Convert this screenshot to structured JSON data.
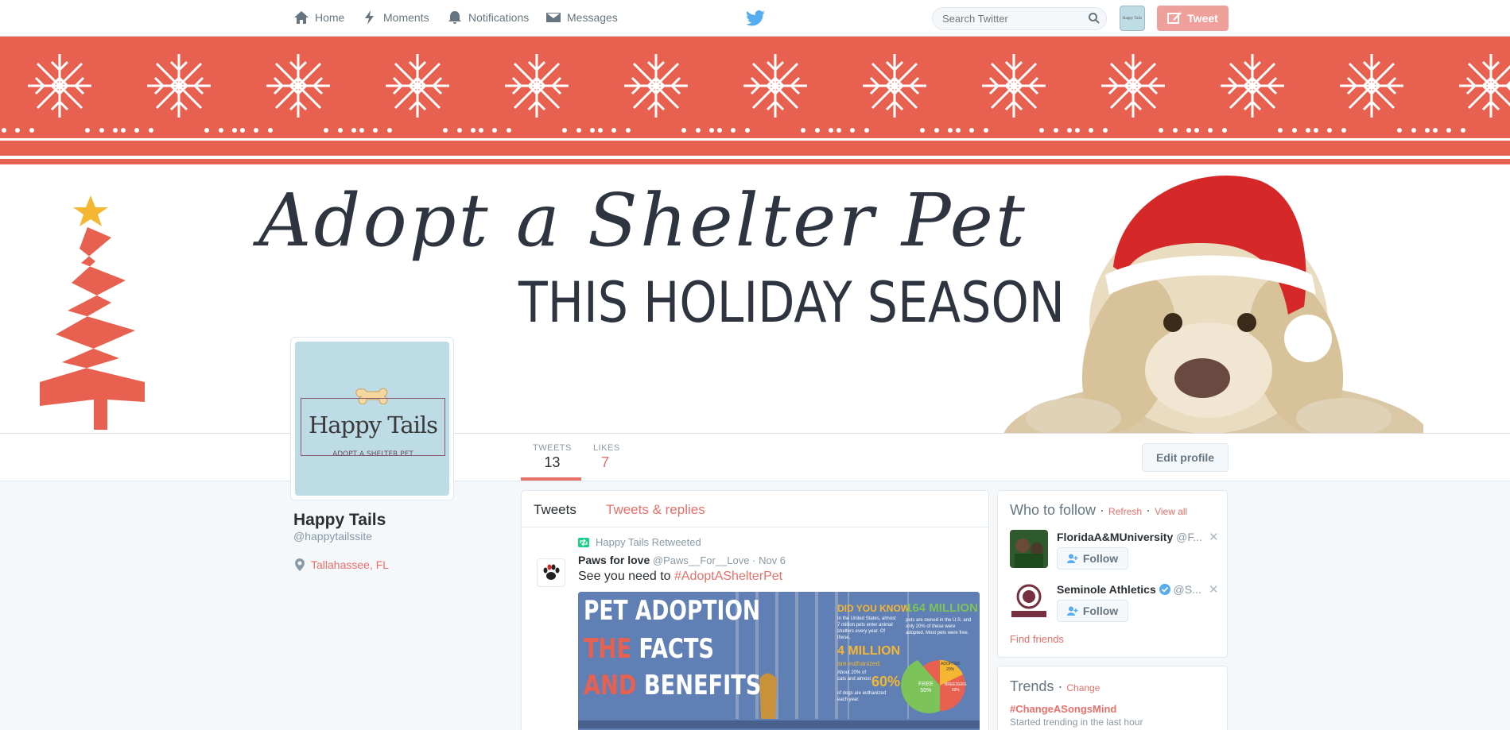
{
  "nav": {
    "home": "Home",
    "moments": "Moments",
    "notifications": "Notifications",
    "messages": "Messages",
    "search_placeholder": "Search Twitter",
    "tweet_button": "Tweet"
  },
  "banner": {
    "headline": "Adopt a Shelter Pet",
    "subline": "THIS HOLIDAY SEASON"
  },
  "profile": {
    "avatar_title": "Happy Tails",
    "avatar_subtitle": "ADOPT A SHELTER PET",
    "name": "Happy Tails",
    "handle": "@happytailssite",
    "location": "Tallahassee, FL",
    "stats": {
      "tweets_label": "TWEETS",
      "tweets_value": "13",
      "likes_label": "LIKES",
      "likes_value": "7"
    },
    "edit_button": "Edit profile"
  },
  "timeline": {
    "tabs": [
      "Tweets",
      "Tweets & replies"
    ],
    "tweet": {
      "retweet_line": "Happy Tails Retweeted",
      "author": "Paws for love",
      "author_handle": "@Paws__For__Love",
      "date": "Nov 6",
      "text": "See you need to ",
      "hashtag": "#AdoptAShelterPet",
      "media": {
        "title_1": "PET ADOPTION",
        "title_2a": "THE",
        "title_2b": "FACTS",
        "title_3a": "AND",
        "title_3b": "BENEFITS",
        "did_you_know": "DID YOU KNOW",
        "fact_text": "In the United States, almost 7 million pets enter animal shelters every year. Of these,",
        "four_million": "4 MILLION",
        "euthanized": "are euthanized.",
        "about_text": "About 20% of cats and almost",
        "sixty": "60%",
        "dogs_text": "of dogs are euthanized each year.",
        "big_number": "164 MILLION",
        "owned_text": "pets are owned in the U.S. and only 20% of these were adopted. Most pets were free.",
        "pie_free": "FREE",
        "pie_free_pct": "50%",
        "pie_adopted": "ADOPTED",
        "pie_adopted_pct": "20%",
        "pie_breeders": "BREEDERS",
        "pie_breeders_pct": "26%"
      }
    }
  },
  "who_to_follow": {
    "title": "Who to follow",
    "refresh": "Refresh",
    "view_all": "View all",
    "items": [
      {
        "name": "FloridaA&MUniversity",
        "handle": "@F...",
        "follow": "Follow"
      },
      {
        "name": "Seminole Athletics",
        "handle": "@S...",
        "follow": "Follow"
      }
    ],
    "find_friends": "Find friends"
  },
  "trends": {
    "title": "Trends",
    "change": "Change",
    "tag": "#ChangeASongsMind",
    "desc": "Started trending in the last hour"
  },
  "colors": {
    "accent": "#e8706a",
    "banner_red": "#e8604f",
    "avatar_bg": "#bedce6",
    "twitter_blue": "#55acee"
  }
}
